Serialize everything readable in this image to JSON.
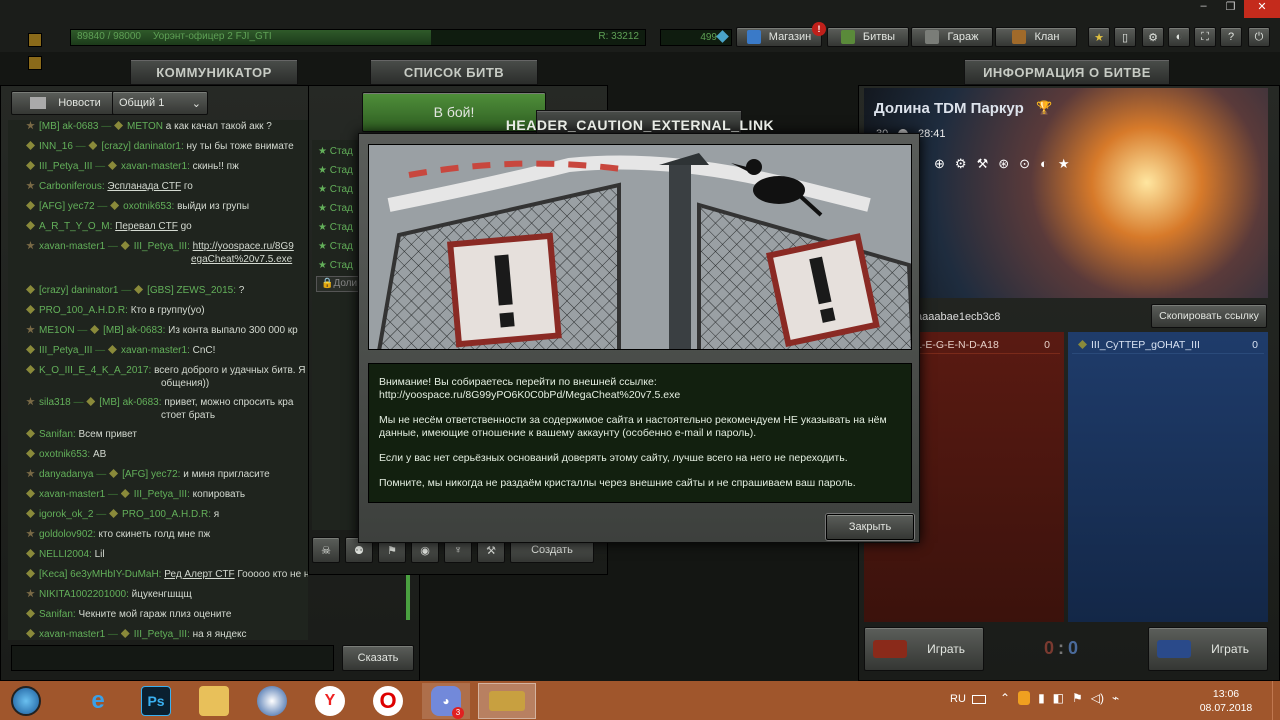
{
  "topbar": {
    "xp_text": "89840 / 98000",
    "rank_name": "Уорэнт-офицер 2 FJI_GTI",
    "rating": "R: 33212",
    "crystals": "499",
    "shop_label": "Магазин",
    "shop_badge": "!",
    "battles_label": "Битвы",
    "garage_label": "Гараж",
    "clan_label": "Клан"
  },
  "communicator": {
    "header": "КОММУНИКАТОР",
    "news_tab": "Новости",
    "channel_select": "Общий 1",
    "say_button": "Сказать",
    "messages": [
      {
        "from": "[MB] ak-0683",
        "to": "METON",
        "text": "а как качал такой акк ?"
      },
      {
        "from": "INN_16",
        "to": "[crazy] daninator1:",
        "text": "ну ты бы тоже внимате"
      },
      {
        "from": "III_Petya_III",
        "to": "xavan-master1:",
        "text": "скинь!! пж"
      },
      {
        "from": "Carboniferous:",
        "to": "",
        "text": "Эспланада CTF",
        "text2": "го"
      },
      {
        "from": "[AFG] yec72",
        "to": "oxotnik653:",
        "text": "выйди из групы"
      },
      {
        "from": "A_R_T_Y_O_M:",
        "to": "",
        "text": "Перевал CTF",
        "text2": "go"
      },
      {
        "from": "xavan-master1",
        "to": "III_Petya_III:",
        "text": "http://yoospace.ru/8G9",
        "text2": "egaCheat%20v7.5.exe"
      },
      {
        "from": "[crazy] daninator1",
        "to": "[GBS] ZEWS_2015:",
        "text": "?"
      },
      {
        "from": "PRO_100_A.H.D.R:",
        "to": "",
        "text": "Кто в группу(yo)"
      },
      {
        "from": "ME1ON",
        "to": "[MB] ak-0683:",
        "text": "Из конта выпало 300 000 кр"
      },
      {
        "from": "III_Petya_III",
        "to": "xavan-master1:",
        "text": "CnC!"
      },
      {
        "from": "K_O_III_E_4_K_A_2017:",
        "to": "",
        "text": "всего доброго и удачных битв. Я",
        "text2": "общения))"
      },
      {
        "from": "sila318",
        "to": "[MB] ak-0683:",
        "text": "привет, можно спросить кра",
        "text2": "стоет брать"
      },
      {
        "from": "Sanifan:",
        "to": "",
        "text": "Всем привет"
      },
      {
        "from": "oxotnik653:",
        "to": "",
        "text": "АВ"
      },
      {
        "from": "danyadanya",
        "to": "[AFG] yec72:",
        "text": "и миня пригласите"
      },
      {
        "from": "xavan-master1",
        "to": "III_Petya_III:",
        "text": "копировать"
      },
      {
        "from": "igorok_ok_2",
        "to": "PRO_100_A.H.D.R:",
        "text": "я"
      },
      {
        "from": "goldolov902:",
        "to": "",
        "text": "кто скинеть голд мне пж"
      },
      {
        "from": "NELLI2004:",
        "to": "",
        "text": "Lil"
      },
      {
        "from": "[Keca] 6e3yMHbIY-DuMaH:",
        "to": "",
        "text": "Ред Алерт CTF",
        "text2": "Гооооо кто не нуб?"
      },
      {
        "from": "NIKITA1002201000:",
        "to": "",
        "text": "йцукенгшщщ"
      },
      {
        "from": "Sanifan:",
        "to": "",
        "text": "Чекните мой гараж плиз оцените"
      },
      {
        "from": "xavan-master1",
        "to": "III_Petya_III:",
        "text": "на я яндекс"
      }
    ]
  },
  "battlelist": {
    "header": "СПИСОК БИТВ",
    "fight_button": "В бой!",
    "items": [
      "Стад",
      "Стад",
      "Стад",
      "Стад",
      "Стад",
      "Стад",
      "Стад"
    ],
    "search_placeholder": "Доли",
    "create_button": "Создать"
  },
  "battleinfo": {
    "header": "ИНФОРМАЦИЯ О БИТВЕ",
    "map_name": "Долина TDM Паркур",
    "players": "30",
    "time": "28:41",
    "link_text": "aaaabae1ecb3c8",
    "copy_link_button": "Скопировать ссылку",
    "red_player": "L-E-G-E-N-D-A18",
    "red_player_score": "0",
    "blue_player": "III_CyTTEP_gOHAT_III",
    "blue_player_score": "0",
    "score_red": "0",
    "score_blue": "0",
    "play_label": "Играть"
  },
  "modal": {
    "title": "HEADER_CAUTION_EXTERNAL_LINK",
    "p1": "Внимание! Вы собираетесь перейти по внешней ссылке:",
    "link": "http://yoospace.ru/8G99yPO6K0C0bPd/MegaCheat%20v7.5.exe",
    "p2": "Мы не несём ответственности за содержимое сайта и настоятельно рекомендуем НЕ указывать на нём данные, имеющие отношение к вашему аккаунту (особенно e-mail и пароль).",
    "p3": "Если у вас нет серьёзных оснований доверять этому сайту, лучше всего на него не переходить.",
    "p4": "Помните, мы никогда не раздаём кристаллы через внешние сайты и не спрашиваем ваш пароль.",
    "close_button": "Закрыть"
  },
  "taskbar": {
    "lang": "RU",
    "time": "13:06",
    "date": "08.07.2018",
    "discord_badge": "3",
    "apps": [
      "start",
      "internet-explorer",
      "photoshop",
      "file-explorer",
      "cinema4d",
      "yandex",
      "opera",
      "discord",
      "tanki"
    ]
  },
  "colors": {
    "accent_green": "#63b05a",
    "red_team": "#5a1a12",
    "blue_team": "#1f3c6b",
    "taskbar": "#a0562c"
  }
}
